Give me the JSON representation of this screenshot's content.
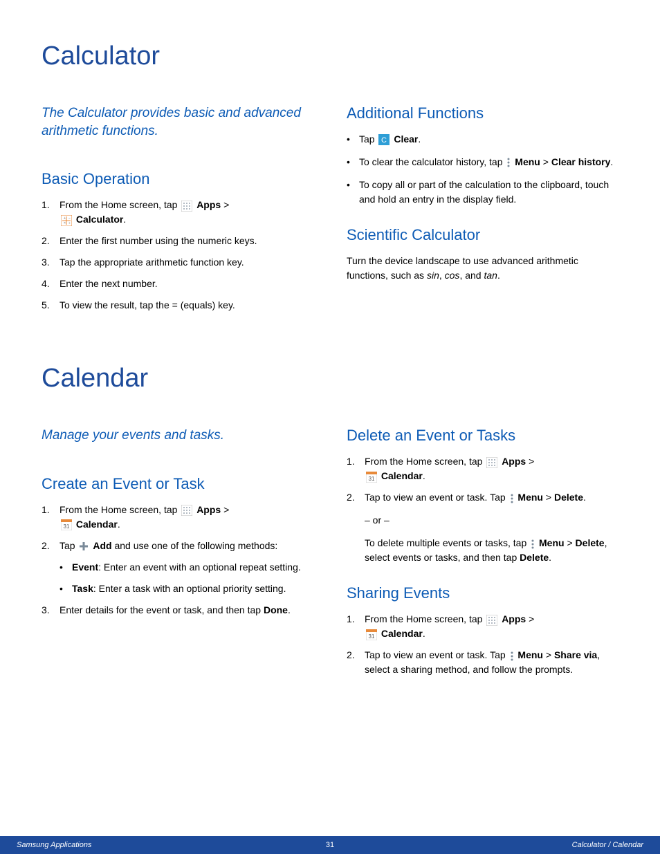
{
  "calculator": {
    "title": "Calculator",
    "intro": "The Calculator provides basic and advanced arithmetic functions.",
    "basic": {
      "title": "Basic Operation",
      "steps": {
        "s1_pre": "From the Home screen, tap ",
        "s1_apps": "Apps",
        "s1_gt": " > ",
        "s1_calc": "Calculator",
        "s1_dot": ".",
        "s2": "Enter the first number using the numeric keys.",
        "s3": "Tap the appropriate arithmetic function key.",
        "s4": "Enter the next number.",
        "s5": "To view the result, tap the = (equals) key."
      }
    },
    "additional": {
      "title": "Additional Functions",
      "b1_pre": "Tap ",
      "b1_clear": "Clear",
      "b1_dot": ".",
      "b2_pre": "To clear the calculator history, tap ",
      "b2_menu": "Menu",
      "b2_gt": " > ",
      "b2_clearhist": "Clear history",
      "b2_dot": ".",
      "b3": "To copy all or part of the calculation to the clipboard, touch and hold an entry in the display field."
    },
    "scientific": {
      "title": "Scientific Calculator",
      "p_pre": "Turn the device landscape to use advanced arithmetic functions, such as ",
      "p_sin": "sin",
      "p_c1": ", ",
      "p_cos": "cos",
      "p_c2": ", and ",
      "p_tan": "tan",
      "p_dot": "."
    }
  },
  "calendar": {
    "title": "Calendar",
    "intro": "Manage your events and tasks.",
    "create": {
      "title": "Create an Event or Task",
      "s1_pre": "From the Home screen, tap ",
      "s1_apps": "Apps",
      "s1_gt": " > ",
      "s1_cal": "Calendar",
      "s1_dot": ".",
      "s2_pre": "Tap ",
      "s2_add": "Add",
      "s2_post": " and use one of the following methods:",
      "sb1_ev": "Event",
      "sb1_post": ": Enter an event with an optional repeat setting.",
      "sb2_tk": "Task",
      "sb2_post": ": Enter a task with an optional priority setting.",
      "s3_pre": "Enter details for the event or task, and then tap ",
      "s3_done": "Done",
      "s3_dot": "."
    },
    "delete": {
      "title": "Delete an Event or Tasks",
      "s1_pre": "From the Home screen, tap ",
      "s1_apps": "Apps",
      "s1_gt": " > ",
      "s1_cal": "Calendar",
      "s1_dot": ".",
      "s2_pre": "Tap to view an event or task. Tap ",
      "s2_menu": "Menu",
      "s2_gt": " > ",
      "s2_del": "Delete",
      "s2_dot": ".",
      "or": "– or –",
      "alt_pre": "To delete multiple events or tasks, tap ",
      "alt_menu": "Menu",
      "alt_gt": " > ",
      "alt_del": "Delete",
      "alt_mid": ", select events or tasks, and then tap ",
      "alt_del2": "Delete",
      "alt_dot": "."
    },
    "sharing": {
      "title": "Sharing Events",
      "s1_pre": "From the Home screen, tap ",
      "s1_apps": "Apps",
      "s1_gt": " > ",
      "s1_cal": "Calendar",
      "s1_dot": ".",
      "s2_pre": "Tap to view an event or task. Tap ",
      "s2_menu": "Menu",
      "s2_gt": " > ",
      "s2_share": "Share via",
      "s2_post": ", select a sharing method, and follow the prompts."
    }
  },
  "footer": {
    "left": "Samsung Applications",
    "center": "31",
    "right": "Calculator / Calendar"
  }
}
